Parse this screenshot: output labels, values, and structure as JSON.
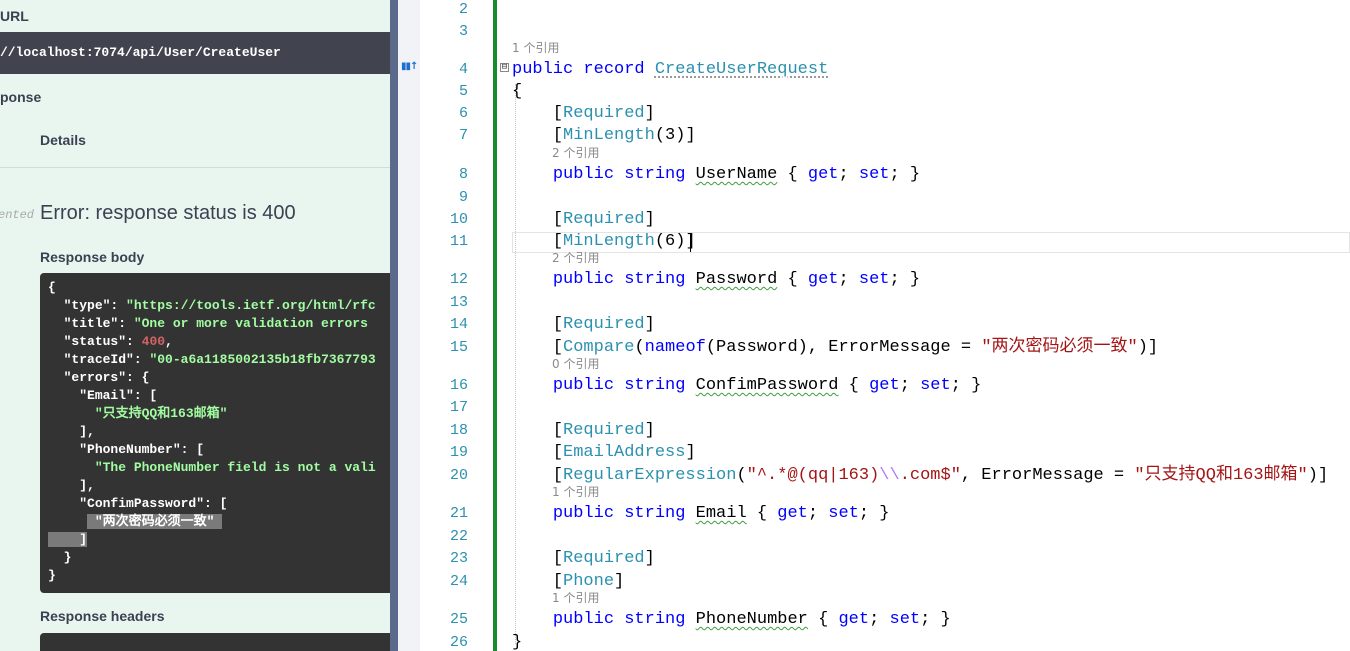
{
  "swagger": {
    "request_url_label": "URL",
    "request_url": "//localhost:7074/api/User/CreateUser",
    "server_response_label": "ponse",
    "details_label": "Details",
    "undocumented_label": "ented",
    "error_text": "Error: response status is 400",
    "response_body_label": "Response body",
    "response_headers_label": "Response headers",
    "json_lines": [
      [
        {
          "t": "p",
          "v": "{"
        }
      ],
      [
        {
          "t": "p",
          "v": "  "
        },
        {
          "t": "k",
          "v": "\"type\""
        },
        {
          "t": "p",
          "v": ": "
        },
        {
          "t": "s",
          "v": "\"https://tools.ietf.org/html/rfc"
        }
      ],
      [
        {
          "t": "p",
          "v": "  "
        },
        {
          "t": "k",
          "v": "\"title\""
        },
        {
          "t": "p",
          "v": ": "
        },
        {
          "t": "s",
          "v": "\"One or more validation errors"
        }
      ],
      [
        {
          "t": "p",
          "v": "  "
        },
        {
          "t": "k",
          "v": "\"status\""
        },
        {
          "t": "p",
          "v": ": "
        },
        {
          "t": "n",
          "v": "400"
        },
        {
          "t": "p",
          "v": ","
        }
      ],
      [
        {
          "t": "p",
          "v": "  "
        },
        {
          "t": "k",
          "v": "\"traceId\""
        },
        {
          "t": "p",
          "v": ": "
        },
        {
          "t": "s",
          "v": "\"00-a6a1185002135b18fb7367793"
        }
      ],
      [
        {
          "t": "p",
          "v": "  "
        },
        {
          "t": "k",
          "v": "\"errors\""
        },
        {
          "t": "p",
          "v": ": {"
        }
      ],
      [
        {
          "t": "p",
          "v": "    "
        },
        {
          "t": "k",
          "v": "\"Email\""
        },
        {
          "t": "p",
          "v": ": ["
        }
      ],
      [
        {
          "t": "p",
          "v": "      "
        },
        {
          "t": "s",
          "v": "\"只支持QQ和163邮箱\""
        }
      ],
      [
        {
          "t": "p",
          "v": "    ],"
        }
      ],
      [
        {
          "t": "p",
          "v": "    "
        },
        {
          "t": "k",
          "v": "\"PhoneNumber\""
        },
        {
          "t": "p",
          "v": ": ["
        }
      ],
      [
        {
          "t": "p",
          "v": "      "
        },
        {
          "t": "s",
          "v": "\"The PhoneNumber field is not a vali"
        }
      ],
      [
        {
          "t": "p",
          "v": "    ],"
        }
      ],
      [
        {
          "t": "p",
          "v": "    "
        },
        {
          "t": "k",
          "v": "\"ConfimPassword\""
        },
        {
          "t": "p",
          "v": ": ["
        }
      ],
      [
        {
          "t": "p",
          "v": "     "
        },
        {
          "t": "sel",
          "v": " \"两次密码必须一致\" "
        }
      ],
      [
        {
          "t": "sel",
          "v": "    ]"
        }
      ],
      [
        {
          "t": "p",
          "v": "  }"
        }
      ],
      [
        {
          "t": "p",
          "v": "}"
        }
      ]
    ]
  },
  "editor": {
    "lines": [
      {
        "n": "2",
        "lens": "",
        "lens_top": false,
        "code": []
      },
      {
        "n": "3",
        "lens": "",
        "lens_top": false,
        "code": []
      },
      {
        "n": "4",
        "lens": "1 个引用",
        "lens_top": true,
        "code": [
          {
            "t": "kw",
            "v": "public"
          },
          {
            "t": "pl",
            "v": " "
          },
          {
            "t": "kw",
            "v": "record"
          },
          {
            "t": "pl",
            "v": " "
          },
          {
            "t": "ty dotted",
            "v": "CreateUserRequest"
          }
        ]
      },
      {
        "n": "5",
        "lens": "",
        "lens_top": false,
        "code": [
          {
            "t": "pl",
            "v": "{"
          }
        ]
      },
      {
        "n": "6",
        "lens": "",
        "lens_top": false,
        "code": [
          {
            "t": "pl",
            "v": "    ["
          },
          {
            "t": "ty",
            "v": "Required"
          },
          {
            "t": "pl",
            "v": "]"
          }
        ]
      },
      {
        "n": "7",
        "lens": "",
        "lens_top": false,
        "code": [
          {
            "t": "pl",
            "v": "    ["
          },
          {
            "t": "ty",
            "v": "MinLength"
          },
          {
            "t": "pl",
            "v": "(3)]"
          }
        ]
      },
      {
        "n": "8",
        "lens": "2 个引用",
        "lens_top": false,
        "code": [
          {
            "t": "pl",
            "v": "    "
          },
          {
            "t": "kw",
            "v": "public"
          },
          {
            "t": "pl",
            "v": " "
          },
          {
            "t": "kw",
            "v": "string"
          },
          {
            "t": "pl",
            "v": " "
          },
          {
            "t": "pl squig",
            "v": "UserName"
          },
          {
            "t": "pl",
            "v": " { "
          },
          {
            "t": "kw",
            "v": "get"
          },
          {
            "t": "pl",
            "v": "; "
          },
          {
            "t": "kw",
            "v": "set"
          },
          {
            "t": "pl",
            "v": "; }"
          }
        ]
      },
      {
        "n": "9",
        "lens": "",
        "lens_top": false,
        "code": []
      },
      {
        "n": "10",
        "lens": "",
        "lens_top": false,
        "code": [
          {
            "t": "pl",
            "v": "    ["
          },
          {
            "t": "ty",
            "v": "Required"
          },
          {
            "t": "pl",
            "v": "]"
          }
        ]
      },
      {
        "n": "11",
        "lens": "",
        "lens_top": false,
        "code": [
          {
            "t": "pl",
            "v": "    ["
          },
          {
            "t": "ty",
            "v": "MinLength"
          },
          {
            "t": "pl",
            "v": "(6)]"
          }
        ]
      },
      {
        "n": "12",
        "lens": "2 个引用",
        "lens_top": false,
        "code": [
          {
            "t": "pl",
            "v": "    "
          },
          {
            "t": "kw",
            "v": "public"
          },
          {
            "t": "pl",
            "v": " "
          },
          {
            "t": "kw",
            "v": "string"
          },
          {
            "t": "pl",
            "v": " "
          },
          {
            "t": "pl squig",
            "v": "Password"
          },
          {
            "t": "pl",
            "v": " { "
          },
          {
            "t": "kw",
            "v": "get"
          },
          {
            "t": "pl",
            "v": "; "
          },
          {
            "t": "kw",
            "v": "set"
          },
          {
            "t": "pl",
            "v": "; }"
          }
        ]
      },
      {
        "n": "13",
        "lens": "",
        "lens_top": false,
        "code": []
      },
      {
        "n": "14",
        "lens": "",
        "lens_top": false,
        "code": [
          {
            "t": "pl",
            "v": "    ["
          },
          {
            "t": "ty",
            "v": "Required"
          },
          {
            "t": "pl",
            "v": "]"
          }
        ]
      },
      {
        "n": "15",
        "lens": "",
        "lens_top": false,
        "code": [
          {
            "t": "pl",
            "v": "    ["
          },
          {
            "t": "ty",
            "v": "Compare"
          },
          {
            "t": "pl",
            "v": "("
          },
          {
            "t": "kw",
            "v": "nameof"
          },
          {
            "t": "pl",
            "v": "(Password), ErrorMessage = "
          },
          {
            "t": "str",
            "v": "\"两次密码必须一致\""
          },
          {
            "t": "pl",
            "v": ")]"
          }
        ]
      },
      {
        "n": "16",
        "lens": "0 个引用",
        "lens_top": false,
        "code": [
          {
            "t": "pl",
            "v": "    "
          },
          {
            "t": "kw",
            "v": "public"
          },
          {
            "t": "pl",
            "v": " "
          },
          {
            "t": "kw",
            "v": "string"
          },
          {
            "t": "pl",
            "v": " "
          },
          {
            "t": "pl squig",
            "v": "ConfimPassword"
          },
          {
            "t": "pl",
            "v": " { "
          },
          {
            "t": "kw",
            "v": "get"
          },
          {
            "t": "pl",
            "v": "; "
          },
          {
            "t": "kw",
            "v": "set"
          },
          {
            "t": "pl",
            "v": "; }"
          }
        ]
      },
      {
        "n": "17",
        "lens": "",
        "lens_top": false,
        "code": []
      },
      {
        "n": "18",
        "lens": "",
        "lens_top": false,
        "code": [
          {
            "t": "pl",
            "v": "    ["
          },
          {
            "t": "ty",
            "v": "Required"
          },
          {
            "t": "pl",
            "v": "]"
          }
        ]
      },
      {
        "n": "19",
        "lens": "",
        "lens_top": false,
        "code": [
          {
            "t": "pl",
            "v": "    ["
          },
          {
            "t": "ty",
            "v": "EmailAddress"
          },
          {
            "t": "pl",
            "v": "]"
          }
        ]
      },
      {
        "n": "20",
        "lens": "",
        "lens_top": false,
        "code": [
          {
            "t": "pl",
            "v": "    ["
          },
          {
            "t": "ty",
            "v": "RegularExpression"
          },
          {
            "t": "pl",
            "v": "("
          },
          {
            "t": "str",
            "v": "\"^.*@(qq|163)"
          },
          {
            "t": "esc",
            "v": "\\\\"
          },
          {
            "t": "str",
            "v": ".com$\""
          },
          {
            "t": "pl",
            "v": ", ErrorMessage = "
          },
          {
            "t": "str",
            "v": "\"只支持QQ和163邮箱\""
          },
          {
            "t": "pl",
            "v": ")]"
          }
        ]
      },
      {
        "n": "21",
        "lens": "1 个引用",
        "lens_top": false,
        "code": [
          {
            "t": "pl",
            "v": "    "
          },
          {
            "t": "kw",
            "v": "public"
          },
          {
            "t": "pl",
            "v": " "
          },
          {
            "t": "kw",
            "v": "string"
          },
          {
            "t": "pl",
            "v": " "
          },
          {
            "t": "pl squig",
            "v": "Email"
          },
          {
            "t": "pl",
            "v": " { "
          },
          {
            "t": "kw",
            "v": "get"
          },
          {
            "t": "pl",
            "v": "; "
          },
          {
            "t": "kw",
            "v": "set"
          },
          {
            "t": "pl",
            "v": "; }"
          }
        ]
      },
      {
        "n": "22",
        "lens": "",
        "lens_top": false,
        "code": []
      },
      {
        "n": "23",
        "lens": "",
        "lens_top": false,
        "code": [
          {
            "t": "pl",
            "v": "    ["
          },
          {
            "t": "ty",
            "v": "Required"
          },
          {
            "t": "pl",
            "v": "]"
          }
        ]
      },
      {
        "n": "24",
        "lens": "",
        "lens_top": false,
        "code": [
          {
            "t": "pl",
            "v": "    ["
          },
          {
            "t": "ty",
            "v": "Phone"
          },
          {
            "t": "pl",
            "v": "]"
          }
        ]
      },
      {
        "n": "25",
        "lens": "1 个引用",
        "lens_top": false,
        "code": [
          {
            "t": "pl",
            "v": "    "
          },
          {
            "t": "kw",
            "v": "public"
          },
          {
            "t": "pl",
            "v": " "
          },
          {
            "t": "kw",
            "v": "string"
          },
          {
            "t": "pl",
            "v": " "
          },
          {
            "t": "pl squig",
            "v": "PhoneNumber"
          },
          {
            "t": "pl",
            "v": " { "
          },
          {
            "t": "kw",
            "v": "get"
          },
          {
            "t": "pl",
            "v": "; "
          },
          {
            "t": "kw",
            "v": "set"
          },
          {
            "t": "pl",
            "v": "; }"
          }
        ]
      },
      {
        "n": "26",
        "lens": "",
        "lens_top": false,
        "code": [
          {
            "t": "pl",
            "v": "}"
          }
        ]
      }
    ],
    "current_line": "11",
    "collapse_glyph": "⊟",
    "codelens_icon": "▮▮↑"
  }
}
